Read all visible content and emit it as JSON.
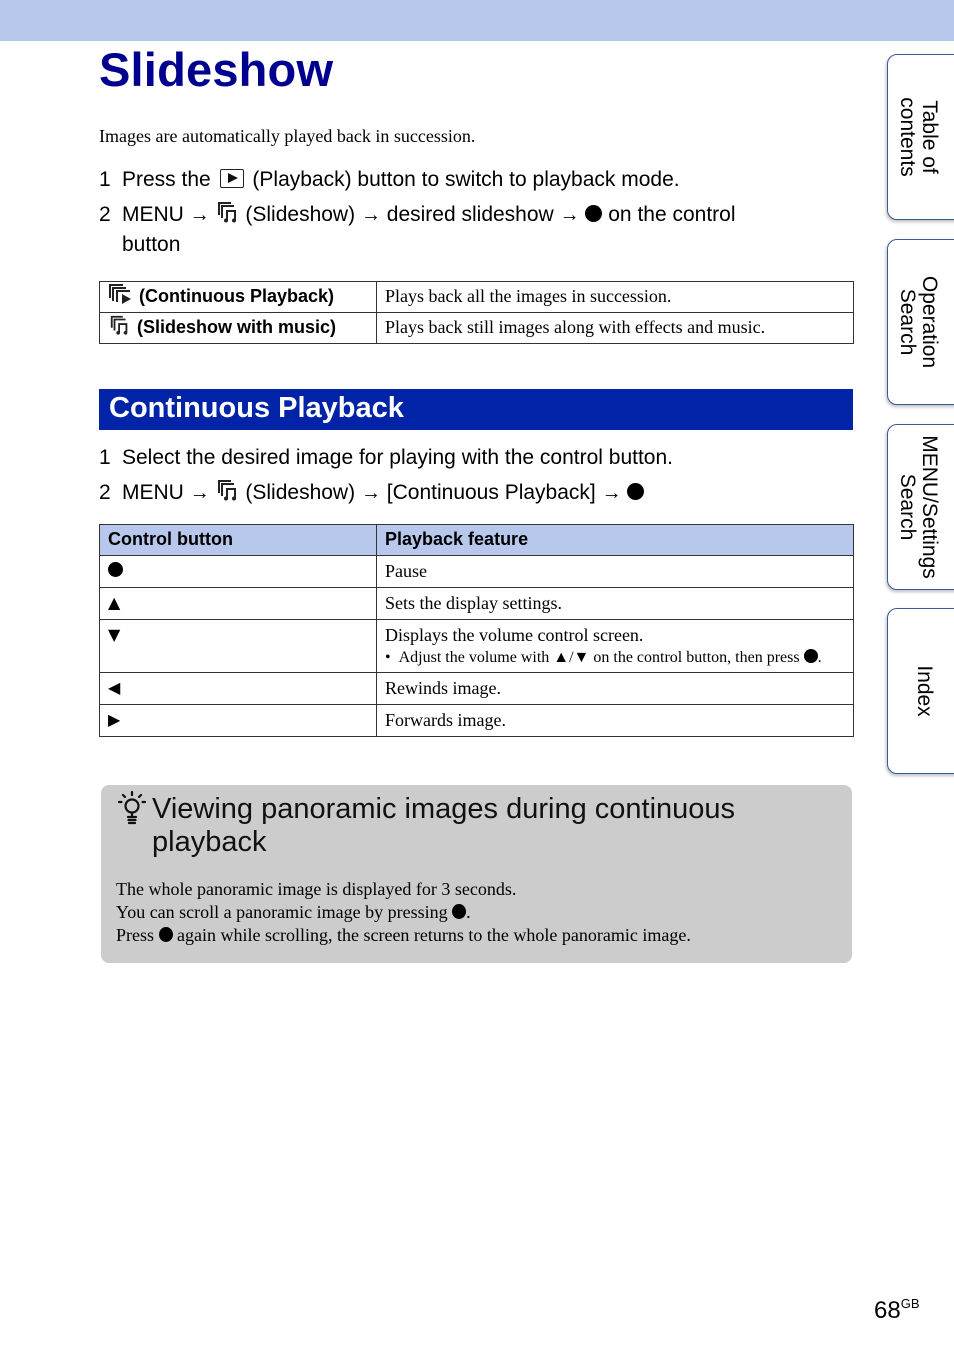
{
  "header": {
    "title": "Slideshow"
  },
  "intro": "Images are automatically played back in succession.",
  "steps": [
    {
      "num": "1",
      "before": "Press the",
      "icon": "playback-button-icon",
      "after": "(Playback) button to switch to playback mode."
    },
    {
      "num": "2",
      "menu": "MENU",
      "arrow": "→",
      "icon": "slideshow-icon",
      "item": "(Slideshow)",
      "middle": "desired slideshow",
      "after": "on the control",
      "after2": "button"
    }
  ],
  "modes": [
    {
      "icon": "continuous-playback-icon",
      "name": "(Continuous Playback)",
      "description": "Plays back all the images in succession."
    },
    {
      "icon": "slideshow-music-icon",
      "name": "(Slideshow with music)",
      "description": "Plays back still images along with effects and music."
    }
  ],
  "section": {
    "title": "Continuous Playback",
    "steps": [
      {
        "num": "1",
        "text": "Select the desired image for playing with the control button."
      },
      {
        "num": "2",
        "menu": "MENU",
        "arrow": "→",
        "item": "(Slideshow)",
        "option": "[Continuous Playback]"
      }
    ],
    "table": {
      "headers": [
        "Control button",
        "Playback feature"
      ],
      "rows": [
        {
          "button": "center",
          "symbol": "●",
          "feature": "Pause"
        },
        {
          "button": "up",
          "symbol": "▲",
          "feature": "Sets the display settings."
        },
        {
          "button": "down",
          "symbol": "▼",
          "feature": "Displays the volume control screen.",
          "note_before": "Adjust the volume with ▲/▼ on the control button, then press",
          "note_after": "."
        },
        {
          "button": "left",
          "symbol": "◀",
          "feature": "Rewinds image."
        },
        {
          "button": "right",
          "symbol": "▶",
          "feature": "Forwards image."
        }
      ]
    }
  },
  "hint": {
    "icon": "lightbulb-hint-icon",
    "title": "Viewing panoramic images during continuous playback",
    "lines": [
      {
        "text": "The whole panoramic image is displayed for 3 seconds."
      },
      {
        "before": "You can scroll a panoramic image by pressing",
        "after": "."
      },
      {
        "before": "Press",
        "after": "again while scrolling, the screen returns to the whole panoramic image."
      }
    ]
  },
  "side_tabs": [
    {
      "label_line1": "Table of",
      "label_line2": "contents"
    },
    {
      "label_line1": "Operation",
      "label_line2": "Search"
    },
    {
      "label_line1": "MENU/Settings",
      "label_line2": "Search"
    },
    {
      "label_line1": "Index",
      "label_line2": ""
    }
  ],
  "page": {
    "number": "68",
    "suffix": "GB"
  },
  "colors": {
    "top_bar": "#b8c7ec",
    "title": "#00008f",
    "section_banner": "#0023a8",
    "table_header": "#b8c7ec",
    "hint_bg": "#cccccc"
  }
}
